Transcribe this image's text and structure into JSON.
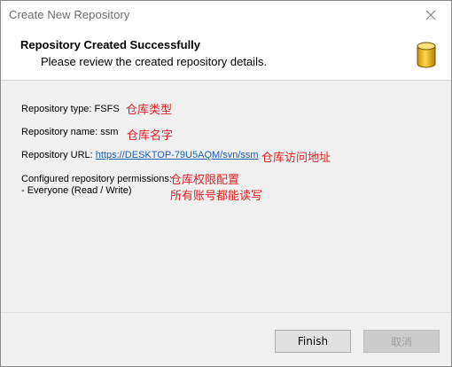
{
  "window": {
    "title": "Create New Repository"
  },
  "header": {
    "title": "Repository Created Successfully",
    "subtitle": "Please review the created repository details."
  },
  "details": {
    "type_label": "Repository type: FSFS",
    "name_label": "Repository name: ssm",
    "url_prefix": "Repository URL: ",
    "url_value": "https://DESKTOP-79U5AQM/svn/ssm",
    "permissions_label": "Configured repository permissions:",
    "permissions_value": "- Everyone (Read / Write)"
  },
  "annotations": {
    "type_note": "仓库类型",
    "name_note": "仓库名字",
    "url_note": "仓库访问地址",
    "permissions_note": "仓库权限配置",
    "permissions_note2": "所有账号都能读写",
    "color": "#e02020"
  },
  "footer": {
    "finish_label": "Finish",
    "cancel_label": "取消"
  },
  "icons": {
    "close": "close-icon",
    "database": "database-icon"
  }
}
